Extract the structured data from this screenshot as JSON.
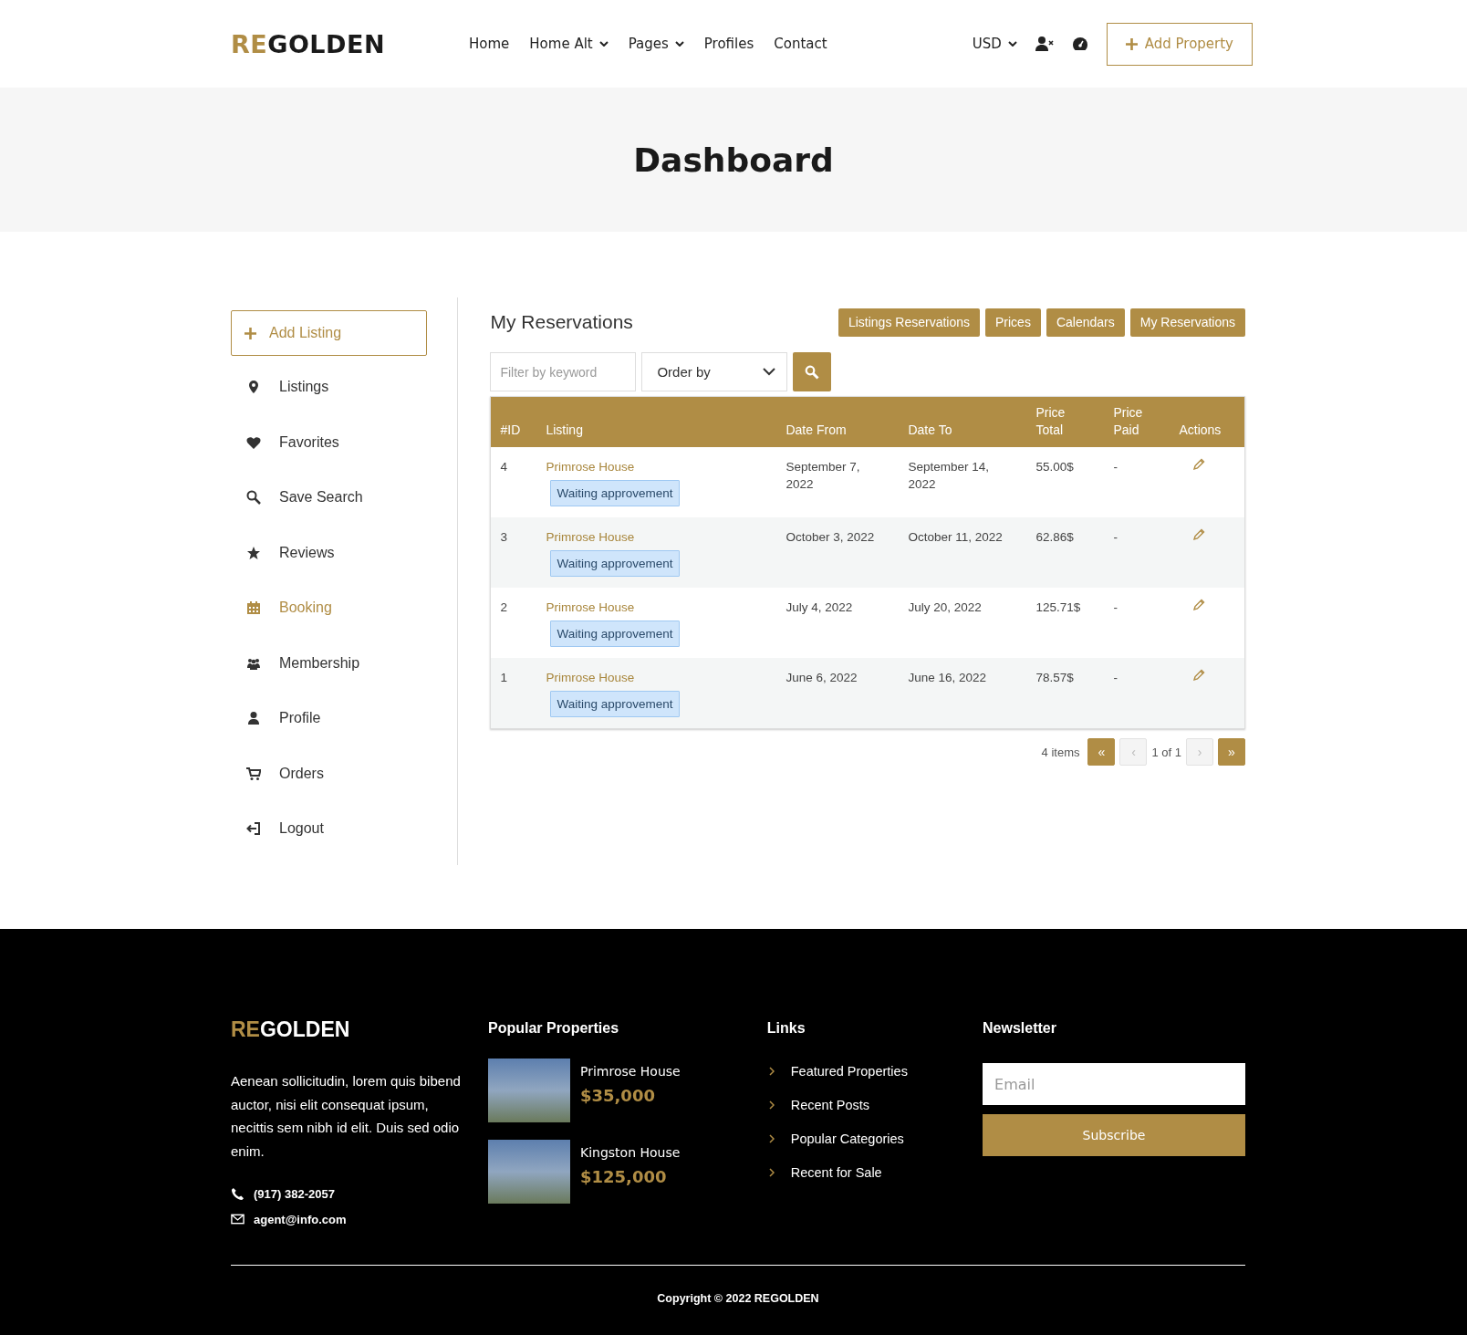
{
  "header": {
    "logo": {
      "accent": "RE",
      "rest": "GOLDEN"
    },
    "nav": [
      {
        "label": "Home",
        "dropdown": false
      },
      {
        "label": "Home Alt",
        "dropdown": true
      },
      {
        "label": "Pages",
        "dropdown": true
      },
      {
        "label": "Profiles",
        "dropdown": false
      },
      {
        "label": "Contact",
        "dropdown": false
      }
    ],
    "currency": "USD",
    "add_button": "Add Property"
  },
  "page_title": "Dashboard",
  "sidebar": {
    "add_button": "Add Listing",
    "items": [
      {
        "label": "Listings",
        "selected": false
      },
      {
        "label": "Favorites",
        "selected": false
      },
      {
        "label": "Save Search",
        "selected": false
      },
      {
        "label": "Reviews",
        "selected": false
      },
      {
        "label": "Booking",
        "selected": true
      },
      {
        "label": "Membership",
        "selected": false
      },
      {
        "label": "Profile",
        "selected": false
      },
      {
        "label": "Orders",
        "selected": false
      },
      {
        "label": "Logout",
        "selected": false
      }
    ]
  },
  "main": {
    "title": "My Reservations",
    "tabs": [
      "Listings Reservations",
      "Prices",
      "Calendars",
      "My Reservations"
    ],
    "filter": {
      "placeholder": "Filter by keyword"
    },
    "order_by": "Order by",
    "table": {
      "columns": [
        "#ID",
        "Listing",
        "Date From",
        "Date To",
        "Price Total",
        "Price Paid",
        "Actions"
      ],
      "rows": [
        {
          "id": "4",
          "listing": "Primrose House",
          "status": "Waiting approvement",
          "date_from": "September 7, 2022",
          "date_to": "September 14, 2022",
          "price_total": "55.00$",
          "price_paid": "-"
        },
        {
          "id": "3",
          "listing": "Primrose House",
          "status": "Waiting approvement",
          "date_from": "October 3, 2022",
          "date_to": "October 11, 2022",
          "price_total": "62.86$",
          "price_paid": "-"
        },
        {
          "id": "2",
          "listing": "Primrose House",
          "status": "Waiting approvement",
          "date_from": "July 4, 2022",
          "date_to": "July 20, 2022",
          "price_total": "125.71$",
          "price_paid": "-"
        },
        {
          "id": "1",
          "listing": "Primrose House",
          "status": "Waiting approvement",
          "date_from": "June 6, 2022",
          "date_to": "June 16, 2022",
          "price_total": "78.57$",
          "price_paid": "-"
        }
      ]
    },
    "pagination": {
      "count": "4 items",
      "page": "1 of 1",
      "buttons": [
        {
          "label": "«",
          "disabled": false
        },
        {
          "label": "‹",
          "disabled": true
        },
        {
          "label": "›",
          "disabled": true
        },
        {
          "label": "»",
          "disabled": false
        }
      ]
    }
  },
  "footer": {
    "logo": {
      "accent": "RE",
      "rest": "GOLDEN"
    },
    "about": "Aenean sollicitudin, lorem quis bibend auctor, nisi elit consequat ipsum, necittis sem nibh id elit. Duis sed odio enim.",
    "phone": "(917) 382-2057",
    "email": "agent@info.com",
    "popular_title": "Popular Properties",
    "properties": [
      {
        "name": "Primrose House",
        "price": "$35,000"
      },
      {
        "name": "Kingston House",
        "price": "$125,000"
      }
    ],
    "links_title": "Links",
    "links": [
      "Featured Properties",
      "Recent Posts",
      "Popular Categories",
      "Recent for Sale"
    ],
    "newsletter_title": "Newsletter",
    "email_placeholder": "Email",
    "subscribe": "Subscribe",
    "copyright": "Copyright © 2022 REGOLDEN"
  }
}
